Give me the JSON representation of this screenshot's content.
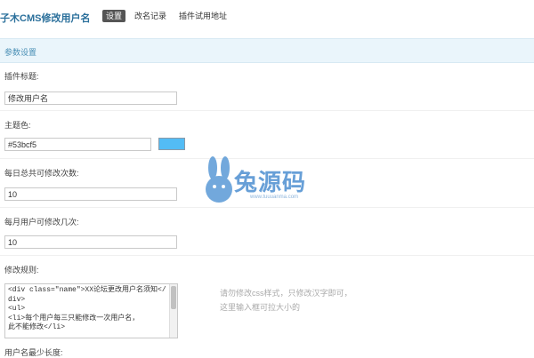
{
  "header": {
    "app_title": "子木CMS修改用户名",
    "tabs": [
      {
        "label": "设置",
        "active": true
      },
      {
        "label": "改名记录",
        "active": false
      },
      {
        "label": "插件试用地址",
        "active": false
      }
    ]
  },
  "section": {
    "title": "参数设置"
  },
  "form": {
    "plugin_title": {
      "label": "插件标题:",
      "value": "修改用户名"
    },
    "theme_color": {
      "label": "主题色:",
      "value": "#53bcf5",
      "swatch": "#53bcf5"
    },
    "daily_limit": {
      "label": "每日总共可修改次数:",
      "value": "10"
    },
    "monthly_limit": {
      "label": "每月用户可修改几次:",
      "value": "10"
    },
    "rules": {
      "label": "修改规则:",
      "value": "<div class=\"name\">XX论坛更改用户名须知</div>\n<ul>\n<li>每个用户每三只能修改一次用户名，\n此不能修改</li>",
      "hint": "请勿修改css样式，只修改汉字即可，\n这里输入框可拉大小的"
    },
    "next_label": "用户名最少长度:"
  },
  "watermark": {
    "text": "兔源码",
    "url": "www.tuuuanma.com"
  },
  "colors": {
    "accent": "#4a8fb5",
    "tab_active_bg": "#555555",
    "section_bg": "#eaf5fb"
  }
}
